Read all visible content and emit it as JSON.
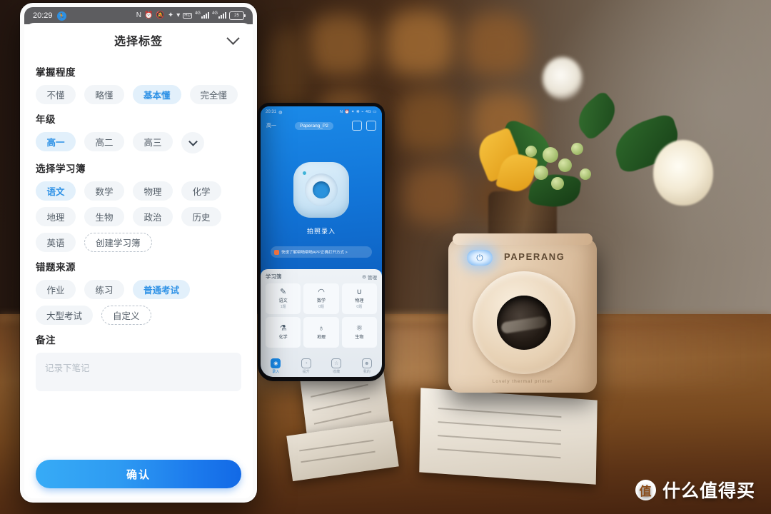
{
  "scene": {
    "watermark": {
      "logo_char": "值",
      "text": "什么值得买"
    },
    "printer": {
      "brand": "PAPERANG",
      "footer": "Lovely thermal printer"
    }
  },
  "phone_background": {
    "status": {
      "time": "20:31",
      "network": "4G"
    },
    "nav": {
      "grade": "高一",
      "device_pill": "Paperang_P2",
      "scan_icon": "scan-icon",
      "print_icon": "print-icon"
    },
    "hero": {
      "caption": "拍照录入"
    },
    "banner": {
      "text": "快速了解噼啪噼啪APP正确打开方式 >"
    },
    "booklet": {
      "title": "学习簿",
      "manage_label": "管理",
      "manage_icon": "gear-icon",
      "cells": [
        {
          "label": "语文",
          "count": "1题",
          "icon": "pen-icon"
        },
        {
          "label": "数学",
          "count": "0题",
          "icon": "ruler-icon"
        },
        {
          "label": "物理",
          "count": "0题",
          "icon": "magnet-icon"
        },
        {
          "label": "化学",
          "count": "",
          "icon": "flask-icon"
        },
        {
          "label": "地理",
          "count": "",
          "icon": "globe-icon"
        },
        {
          "label": "生物",
          "count": "",
          "icon": "molecule-icon"
        }
      ]
    },
    "tabs": [
      {
        "label": "录入",
        "icon": "camera-icon",
        "active": true
      },
      {
        "label": "提升",
        "icon": "chart-icon",
        "active": false
      },
      {
        "label": "收藏",
        "icon": "star-icon",
        "active": false
      },
      {
        "label": "我的",
        "icon": "user-icon",
        "active": false
      }
    ]
  },
  "phone_foreground": {
    "statusbar": {
      "time": "20:29",
      "running_icon": "running-person-icon",
      "icons": [
        "nfc-icon",
        "alarm-icon",
        "silent-bell-icon",
        "bluetooth-icon",
        "wifi-icon",
        "hd-icon"
      ],
      "signal_label": "4G",
      "battery_level": "25"
    },
    "header": {
      "title": "选择标签",
      "collapse_icon": "chevron-down-icon"
    },
    "sections": [
      {
        "key": "mastery",
        "title": "掌握程度",
        "chips": [
          {
            "label": "不懂",
            "selected": false
          },
          {
            "label": "略懂",
            "selected": false
          },
          {
            "label": "基本懂",
            "selected": true
          },
          {
            "label": "完全懂",
            "selected": false
          }
        ]
      },
      {
        "key": "grade",
        "title": "年级",
        "chips": [
          {
            "label": "高一",
            "selected": true
          },
          {
            "label": "高二",
            "selected": false
          },
          {
            "label": "高三",
            "selected": false
          }
        ],
        "more": {
          "icon": "chevron-down-icon"
        }
      },
      {
        "key": "notebook",
        "title": "选择学习簿",
        "chips": [
          {
            "label": "语文",
            "selected": true
          },
          {
            "label": "数学",
            "selected": false
          },
          {
            "label": "物理",
            "selected": false
          },
          {
            "label": "化学",
            "selected": false
          },
          {
            "label": "地理",
            "selected": false
          },
          {
            "label": "生物",
            "selected": false
          },
          {
            "label": "政治",
            "selected": false
          },
          {
            "label": "历史",
            "selected": false
          },
          {
            "label": "英语",
            "selected": false
          },
          {
            "label": "创建学习簿",
            "selected": false,
            "style": "dashed"
          }
        ]
      },
      {
        "key": "source",
        "title": "错题来源",
        "chips": [
          {
            "label": "作业",
            "selected": false
          },
          {
            "label": "练习",
            "selected": false
          },
          {
            "label": "普通考试",
            "selected": true
          },
          {
            "label": "大型考试",
            "selected": false
          },
          {
            "label": "自定义",
            "selected": false,
            "style": "dashed"
          }
        ]
      }
    ],
    "note": {
      "title": "备注",
      "placeholder": "记录下笔记",
      "value": ""
    },
    "confirm": {
      "label": "确认"
    }
  },
  "colors": {
    "accent": "#2f92e6",
    "chip_selected_bg": "#e2f0fb",
    "chip_bg": "#f2f5f8",
    "button_gradient_from": "#37abf6",
    "button_gradient_to": "#1269e6",
    "statusbar_bg": "#5d5d60"
  }
}
